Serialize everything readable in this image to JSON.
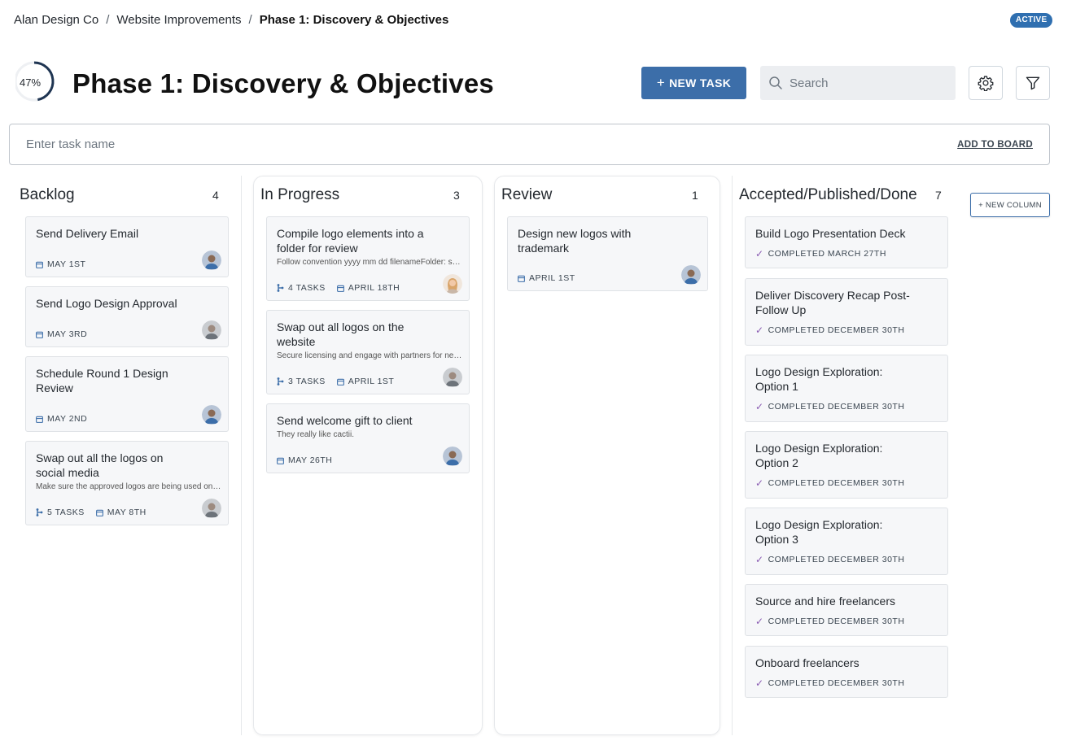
{
  "breadcrumb": {
    "org": "Alan Design Co",
    "project": "Website Improvements",
    "current": "Phase 1: Discovery & Objectives",
    "separator": "/"
  },
  "status_badge": "ACTIVE",
  "header": {
    "progress": "47%",
    "progress_value": 0.47,
    "title": "Phase 1: Discovery & Objectives",
    "new_task_label": "NEW TASK",
    "new_task_icon": "+",
    "search_placeholder": "Search"
  },
  "add_bar": {
    "placeholder": "Enter task name",
    "action_label": "ADD TO BOARD"
  },
  "new_column_label": "+ NEW COLUMN",
  "colors": {
    "accent": "#3c6ea9",
    "badge": "#2f6fb0",
    "check": "#8a5cb3"
  },
  "columns": [
    {
      "name": "Backlog",
      "count": "4",
      "cards": [
        {
          "title": "Send Delivery Email",
          "date": "MAY 1ST",
          "avatar": "avatar-male-blue"
        },
        {
          "title": "Send Logo Design Approval",
          "date": "MAY 3RD",
          "avatar": "avatar-male-grey"
        },
        {
          "title": "Schedule Round 1 Design Review",
          "date": "MAY 2ND",
          "avatar": "avatar-male-blue"
        },
        {
          "title": "Swap out all the logos on social media",
          "desc": "Make sure the approved logos are being used on all social platforms",
          "tasks": "5 TASKS",
          "date": "MAY 8TH",
          "avatar": "avatar-male-grey"
        }
      ]
    },
    {
      "name": "In Progress",
      "count": "3",
      "cards": [
        {
          "title": "Compile logo elements into a folder for review",
          "desc": "Follow convention yyyy mm dd filenameFolder: shared drive",
          "tasks": "4 TASKS",
          "date": "APRIL 18TH",
          "avatar": "avatar-female"
        },
        {
          "title": "Swap out all logos on the website",
          "desc": "Secure licensing and engage with partners for new assets",
          "tasks": "3 TASKS",
          "date": "APRIL 1ST",
          "avatar": "avatar-male-grey"
        },
        {
          "title": "Send welcome gift to client",
          "desc": "They really like cactii.",
          "date": "MAY 26TH",
          "avatar": "avatar-male-blue"
        }
      ]
    },
    {
      "name": "Review",
      "count": "1",
      "cards": [
        {
          "title": "Design new logos with trademark",
          "date": "APRIL 1ST",
          "avatar": "avatar-male-blue"
        }
      ]
    },
    {
      "name": "Accepted/Published/Done",
      "count": "7",
      "cards": [
        {
          "title": "Build Logo Presentation Deck",
          "completed": "COMPLETED MARCH 27TH"
        },
        {
          "title": "Deliver Discovery Recap Post-Follow Up",
          "completed": "COMPLETED DECEMBER 30TH"
        },
        {
          "title": "Logo Design Exploration: Option 1",
          "completed": "COMPLETED DECEMBER 30TH"
        },
        {
          "title": "Logo Design Exploration: Option 2",
          "completed": "COMPLETED DECEMBER 30TH"
        },
        {
          "title": "Logo Design Exploration: Option 3",
          "completed": "COMPLETED DECEMBER 30TH"
        },
        {
          "title": "Source and hire freelancers",
          "completed": "COMPLETED DECEMBER 30TH"
        },
        {
          "title": "Onboard freelancers",
          "completed": "COMPLETED DECEMBER 30TH"
        }
      ]
    }
  ]
}
